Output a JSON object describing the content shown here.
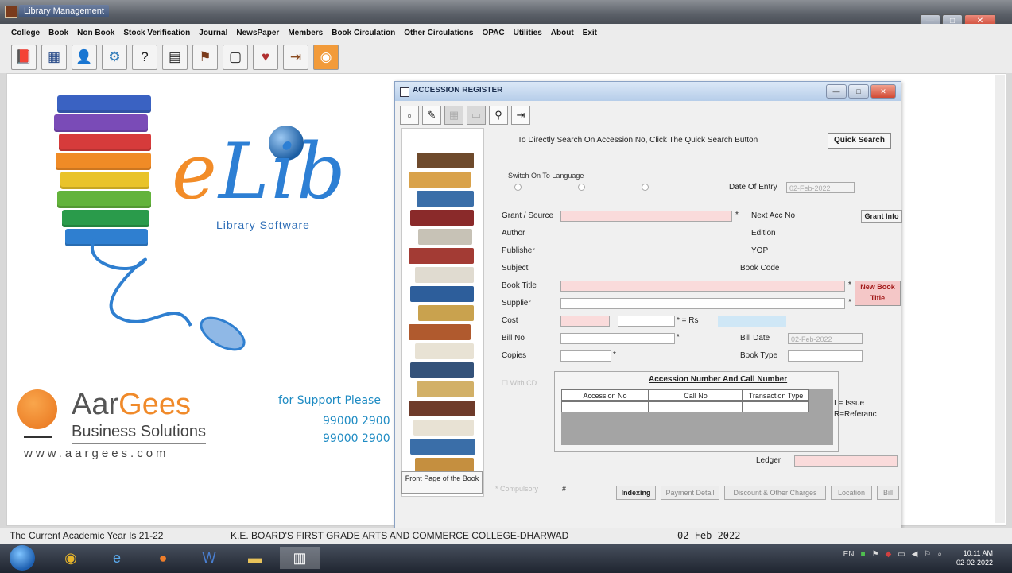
{
  "window": {
    "title": "Library Management"
  },
  "window_buttons": {
    "minimize": "—",
    "maximize": "□",
    "close": "✕"
  },
  "menu": [
    "College",
    "Book",
    "Non Book",
    "Stock Verification",
    "Journal",
    "NewsPaper",
    "Members",
    "Book Circulation",
    "Other Circulations",
    "OPAC",
    "Utilities",
    "About",
    "Exit"
  ],
  "toolbar_icons": [
    "book-icon",
    "calendar-table-icon",
    "member-icon",
    "network-icon",
    "person-help-icon",
    "id-card-icon",
    "bookmark-icon",
    "document-icon",
    "heart-book-icon",
    "exit-door-icon",
    "rss-icon"
  ],
  "branding": {
    "elib_e": "e",
    "elib_lib": "Lib",
    "tagline": "Library Software",
    "company_aar": "Aar",
    "company_gees": "Gees",
    "company_sub": "Business Solutions",
    "website": "www.aargees.com",
    "support": "for Support Please",
    "phone1": "99000 2900",
    "phone2": "99000 2900"
  },
  "accession": {
    "title": "ACCESSION REGISTER",
    "hint": "To Directly Search On Accession No, Click The Quick Search Button",
    "quick_search": "Quick Search",
    "switch_language": "Switch On To Language",
    "date_of_entry": "Date Of Entry",
    "date_value": "02-Feb-2022",
    "grant_source": "Grant / Source",
    "next_acc_no": "Next Acc No",
    "grant_info": "Grant Info",
    "author": "Author",
    "edition": "Edition",
    "publisher": "Publisher",
    "yop": "YOP",
    "subject": "Subject",
    "book_code": "Book Code",
    "book_title": "Book Title",
    "new_book_title": "New Book Title",
    "supplier": "Supplier",
    "cost": "Cost",
    "rs": "= Rs",
    "bill_no": "Bill No",
    "bill_date": "Bill Date",
    "bill_date_value": "02-Feb-2022",
    "copies": "Copies",
    "book_type": "Book Type",
    "with_cd": "With CD",
    "grid_title": "Accession Number And Call Number",
    "grid_cols": [
      "Accession No",
      "Call No",
      "Transaction Type"
    ],
    "issue_legend": "I = Issue",
    "referance_legend": "R=Referanc",
    "ledger": "Ledger",
    "compulsory": "* Compulsory",
    "hash": "#",
    "front_page": "Front Page of the Book",
    "bottom_buttons": [
      "Indexing",
      "Payment Detail",
      "Discount & Other Charges",
      "Location",
      "Bill"
    ]
  },
  "status": {
    "academic_year": "The Current Academic Year Is 21-22",
    "college": "K.E. BOARD'S FIRST GRADE ARTS AND COMMERCE COLLEGE-DHARWAD",
    "date": "02-Feb-2022"
  },
  "taskbar": {
    "language": "EN",
    "time": "10:11 AM",
    "date": "02-02-2022"
  }
}
